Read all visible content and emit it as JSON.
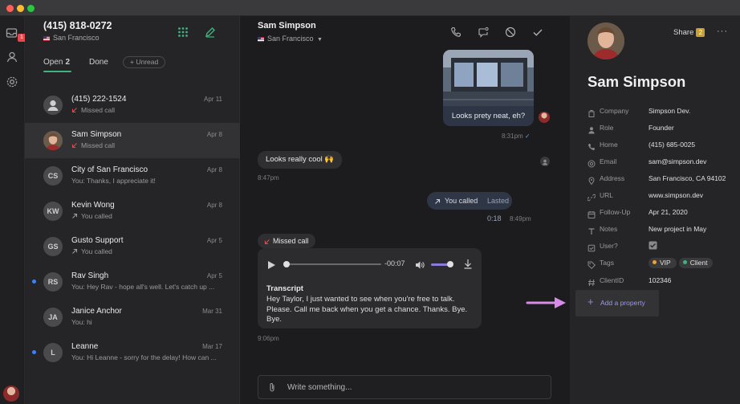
{
  "colors": {
    "accent_green": "#3fb37f",
    "unread_blue": "#3b82f6",
    "vip_orange": "#f0a03a",
    "client_green": "#3fb37f",
    "arrow_pink": "#d88be8",
    "badge_red": "#e5484d"
  },
  "rail": {
    "inbox_badge": "1"
  },
  "inbox": {
    "phone": "(415) 818-0272",
    "location": "San Francisco",
    "tabs": [
      {
        "label": "Open",
        "count": "2"
      },
      {
        "label": "Done",
        "count": ""
      }
    ],
    "unread_label": "+ Unread",
    "conversations": [
      {
        "name": "(415) 222-1524",
        "sub": "Missed call",
        "date": "Apr 11",
        "initials": "",
        "icon": "missed-call-icon",
        "unread": false
      },
      {
        "name": "Sam Simpson",
        "sub": "Missed call",
        "date": "Apr 8",
        "initials": "",
        "icon": "missed-call-icon",
        "unread": false
      },
      {
        "name": "City of San Francisco",
        "sub": "You: Thanks, I appreciate it!",
        "date": "Apr 8",
        "initials": "CS",
        "icon": "",
        "unread": false
      },
      {
        "name": "Kevin Wong",
        "sub": "You called",
        "date": "Apr 8",
        "initials": "KW",
        "icon": "outgoing-call-icon",
        "unread": false
      },
      {
        "name": "Gusto Support",
        "sub": "You called",
        "date": "Apr 5",
        "initials": "GS",
        "icon": "outgoing-call-icon",
        "unread": false
      },
      {
        "name": "Rav Singh",
        "sub": "You: Hey Rav - hope all's well. Let's catch up ...",
        "date": "Apr 5",
        "initials": "RS",
        "icon": "",
        "unread": true
      },
      {
        "name": "Janice Anchor",
        "sub": "You: hi",
        "date": "Mar 31",
        "initials": "JA",
        "icon": "",
        "unread": false
      },
      {
        "name": "Leanne",
        "sub": "You: Hi Leanne - sorry for the delay! How can ...",
        "date": "Mar 17",
        "initials": "L",
        "icon": "",
        "unread": true
      }
    ]
  },
  "chat": {
    "title": "Sam Simpson",
    "location": "San Francisco",
    "photo_caption": "Looks prety neat, eh?",
    "photo_time": "8:31pm",
    "msg_incoming": "Looks really cool 🙌",
    "msg_incoming_time": "8:47pm",
    "you_called": "You called",
    "lasted": "Lasted 0:18",
    "you_called_time": "8:49pm",
    "missed_call": "Missed call",
    "vm_time": "-00:07",
    "transcript_label": "Transcript",
    "transcript_text": "Hey Taylor, I just wanted to see when you're free to talk. Please. Call me back when you get a chance. Thanks. Bye. Bye.",
    "vm_timestamp": "9:06pm",
    "composer_placeholder": "Write something..."
  },
  "profile": {
    "share_label": "Share",
    "share_count": "2",
    "name": "Sam Simpson",
    "fields": [
      {
        "label": "Company",
        "value": "Simpson Dev.",
        "icon": "building-icon"
      },
      {
        "label": "Role",
        "value": "Founder",
        "icon": "person-icon"
      },
      {
        "label": "Home",
        "value": "(415) 685-0025",
        "icon": "phone-icon"
      },
      {
        "label": "Email",
        "value": "sam@simpson.dev",
        "icon": "at-icon"
      },
      {
        "label": "Address",
        "value": "San Francisco, CA 94102",
        "icon": "pin-icon"
      },
      {
        "label": "URL",
        "value": "www.simpson.dev",
        "icon": "link-icon"
      },
      {
        "label": "Follow-Up",
        "value": "Apr 21, 2020",
        "icon": "calendar-icon"
      },
      {
        "label": "Notes",
        "value": "New project in May",
        "icon": "text-icon"
      },
      {
        "label": "User?",
        "value": "",
        "icon": "checkbox-icon"
      },
      {
        "label": "Tags",
        "value": "",
        "icon": "tag-icon"
      },
      {
        "label": "ClientID",
        "value": "102346",
        "icon": "hash-icon"
      }
    ],
    "tags": [
      "VIP",
      "Client"
    ],
    "add_property": "Add a property"
  }
}
